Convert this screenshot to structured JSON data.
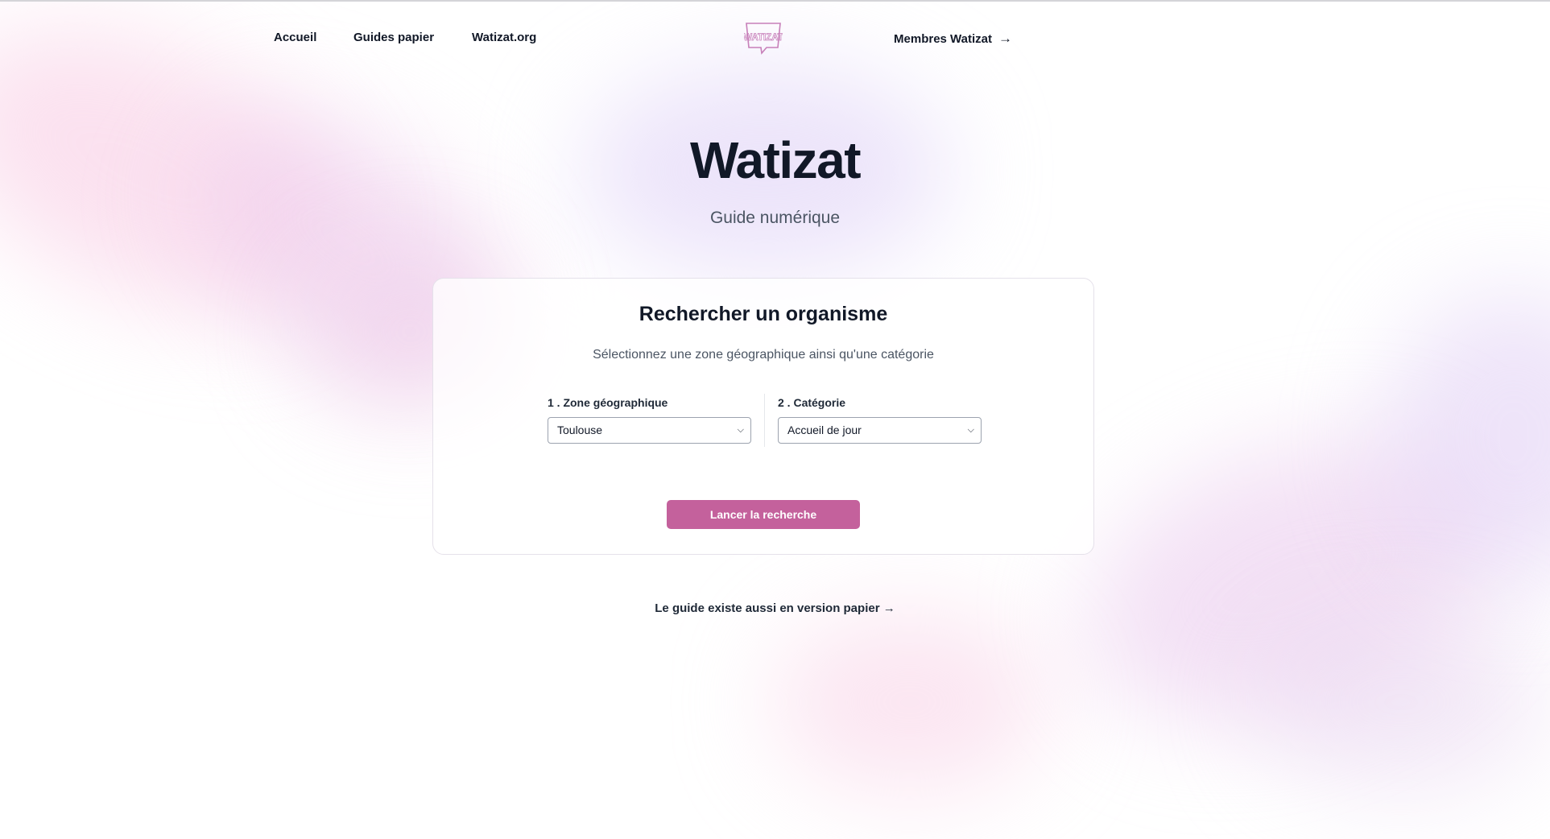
{
  "nav": {
    "links": [
      {
        "label": "Accueil"
      },
      {
        "label": "Guides papier"
      },
      {
        "label": "Watizat.org"
      }
    ],
    "logo_text": "WATIZAT",
    "members_label": "Membres Watizat",
    "members_arrow": "→"
  },
  "hero": {
    "title": "Watizat",
    "subtitle": "Guide numérique"
  },
  "search_card": {
    "title": "Rechercher un organisme",
    "subtitle": "Sélectionnez une zone géographique ainsi qu'une catégorie",
    "zone": {
      "label": "1 . Zone géographique",
      "selected": "Toulouse"
    },
    "category": {
      "label": "2 . Catégorie",
      "selected": "Accueil de jour"
    },
    "submit_label": "Lancer la recherche"
  },
  "paper_link": {
    "label": "Le guide existe aussi en version papier",
    "arrow": "→"
  },
  "colors": {
    "accent": "#c4619c",
    "logo": "#c77fb9",
    "text": "#111827"
  }
}
